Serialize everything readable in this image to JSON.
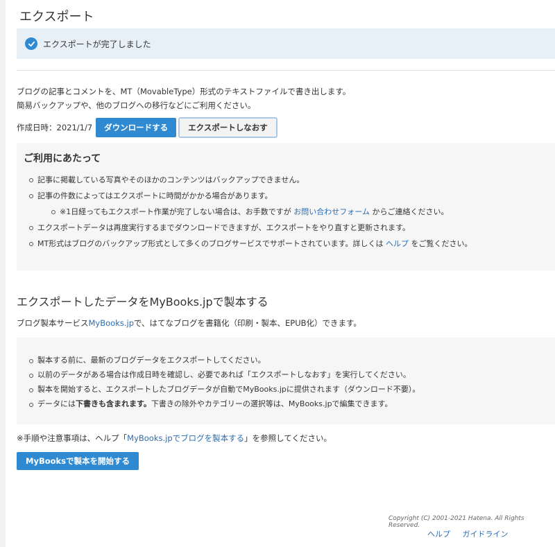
{
  "page": {
    "title": "エクスポート"
  },
  "notice": {
    "text": "エクスポートが完了しました",
    "icon": "check-circle-icon",
    "color": "#2f8ad2"
  },
  "description": {
    "line1": "ブログの記事とコメントを、MT（MovableType）形式のテキストファイルで書き出します。",
    "line2": "簡易バックアップや、他のブログへの移行などにご利用ください。"
  },
  "export": {
    "created_label": "作成日時：2021/1/7",
    "download_label": "ダウンロードする",
    "reexport_label": "エクスポートしなおす"
  },
  "usage": {
    "heading": "ご利用にあたって",
    "items": {
      "item1": "記事に掲載している写真やそのほかのコンテンツはバックアップできません。",
      "item2": "記事の件数によってはエクスポートに時間がかかる場合があります。",
      "item3_prefix": "※1日経ってもエクスポート作業が完了しない場合は、お手数ですが",
      "item3_link": "お問い合わせフォーム",
      "item3_suffix": "からご連絡ください。",
      "item4": "エクスポートデータは再度実行するまでダウンロードできますが、エクスポートをやり直すと更新されます。",
      "item5_prefix": "MT形式はブログのバックアップ形式として多くのブログサービスでサポートされています。詳しくは",
      "item5_link": "ヘルプ",
      "item5_suffix": "をご覧ください。"
    }
  },
  "mybooks": {
    "title": "エクスポートしたデータをMyBooks.jpで製本する",
    "desc_prefix": "ブログ製本サービス",
    "desc_link": "MyBooks.jp",
    "desc_suffix": "で、はてなブログを書籍化（印刷・製本、EPUB化）できます。",
    "items": {
      "item1": "製本する前に、最新のブログデータをエクスポートしてください。",
      "item2": "以前のデータがある場合は作成日時を確認し、必要であれば「エクスポートしなおす」を実行してください。",
      "item3": "製本を開始すると、エクスポートしたブログデータが自動でMyBooks.jpに提供されます（ダウンロード不要）。",
      "item4_prefix": "データには",
      "item4_bold": "下書きも含まれます。",
      "item4_suffix": "下書きの除外やカテゴリーの選択等は、MyBooks.jpで編集できます。"
    },
    "note_prefix": "※手順や注意事項は、ヘルプ「",
    "note_link": "MyBooks.jpでブログを製本する",
    "note_suffix": "」を参照してください。",
    "start_label": "MyBooksで製本を開始する"
  },
  "footer": {
    "copyright": "Copyright (C) 2001-2021 Hatena. All Rights Reserved.",
    "help_label": "ヘルプ",
    "guideline_label": "ガイドライン"
  }
}
